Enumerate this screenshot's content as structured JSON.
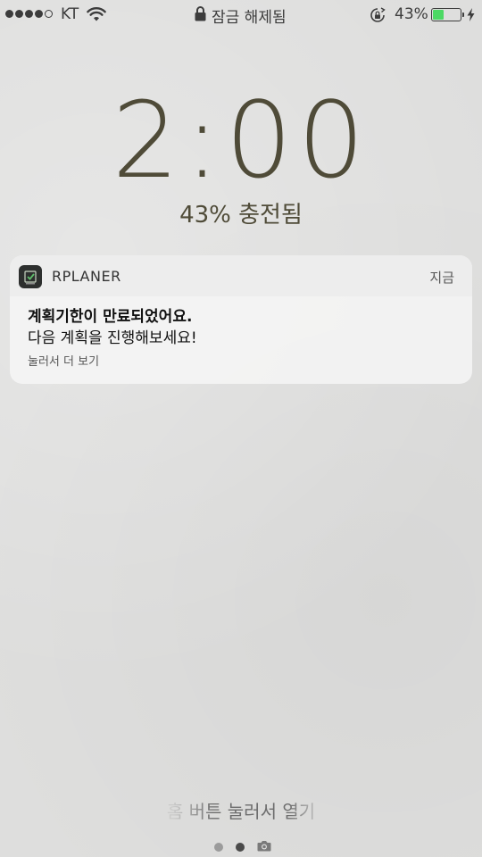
{
  "status_bar": {
    "signal_bars_total": 5,
    "signal_bars_filled": 4,
    "carrier": "KT",
    "lock_status": "잠금 해제됨",
    "battery_percent_text": "43%",
    "battery_level": 0.43,
    "battery_color": "#4cd964"
  },
  "lock_screen": {
    "time": "2:00",
    "charge_status": "43% 충전됨"
  },
  "notification": {
    "app_name": "RPLANER",
    "time": "지금",
    "title": "계획기한이 만료되었어요.",
    "message": "다음 계획을 진행해보세요!",
    "action_hint": "눌러서 더 보기"
  },
  "bottom": {
    "unlock_hint": "홈 버튼 눌러서 열기",
    "pages_total": 2,
    "active_page": 2
  },
  "colors": {
    "clock": "#4f4b38",
    "app_icon": "#2d2f2e"
  },
  "icons": [
    "wifi-icon",
    "lock-icon",
    "orientation-lock-icon",
    "battery-icon",
    "charging-bolt-icon",
    "camera-icon",
    "app-icon"
  ]
}
